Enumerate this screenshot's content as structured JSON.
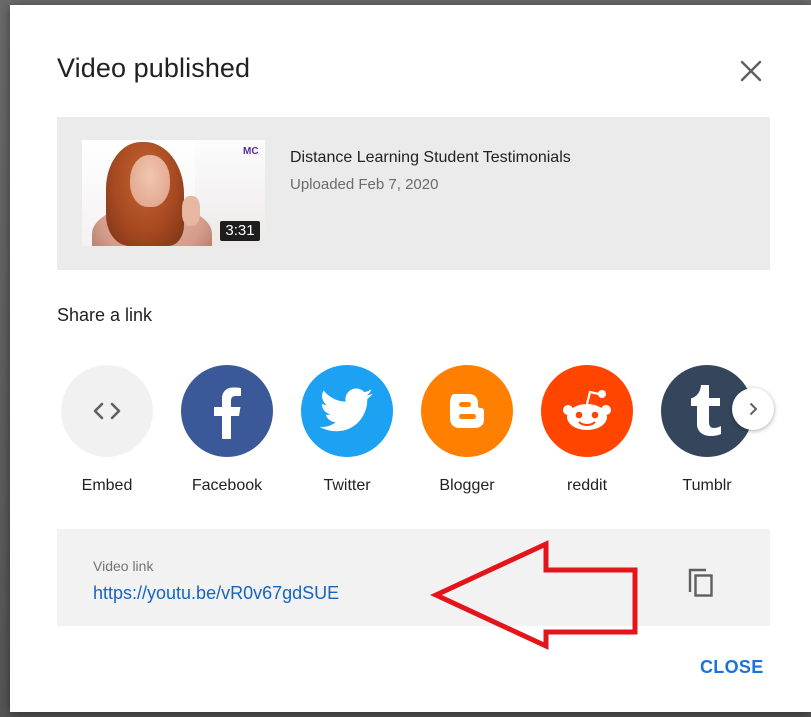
{
  "dialog": {
    "title": "Video published",
    "close_icon": "close-icon"
  },
  "video": {
    "title": "Distance Learning Student Testimonials",
    "upload_date": "Uploaded Feb 7, 2020",
    "duration": "3:31",
    "logo_text": "MC"
  },
  "share": {
    "label": "Share a link",
    "items": [
      {
        "label": "Embed",
        "icon": "embed-icon",
        "color": "#f1f1f1"
      },
      {
        "label": "Facebook",
        "icon": "facebook-icon",
        "color": "#3b5998"
      },
      {
        "label": "Twitter",
        "icon": "twitter-icon",
        "color": "#1da1f2"
      },
      {
        "label": "Blogger",
        "icon": "blogger-icon",
        "color": "#ff8000"
      },
      {
        "label": "reddit",
        "icon": "reddit-icon",
        "color": "#ff4500"
      },
      {
        "label": "Tumblr",
        "icon": "tumblr-icon",
        "color": "#35465c"
      }
    ],
    "next_icon": "chevron-right-icon"
  },
  "link": {
    "label": "Video link",
    "url": "https://youtu.be/vR0v67gdSUE",
    "copy_icon": "copy-icon"
  },
  "footer": {
    "close_label": "CLOSE"
  },
  "colors": {
    "accent": "#1a73d6",
    "annotation_arrow": "#e3151a"
  }
}
